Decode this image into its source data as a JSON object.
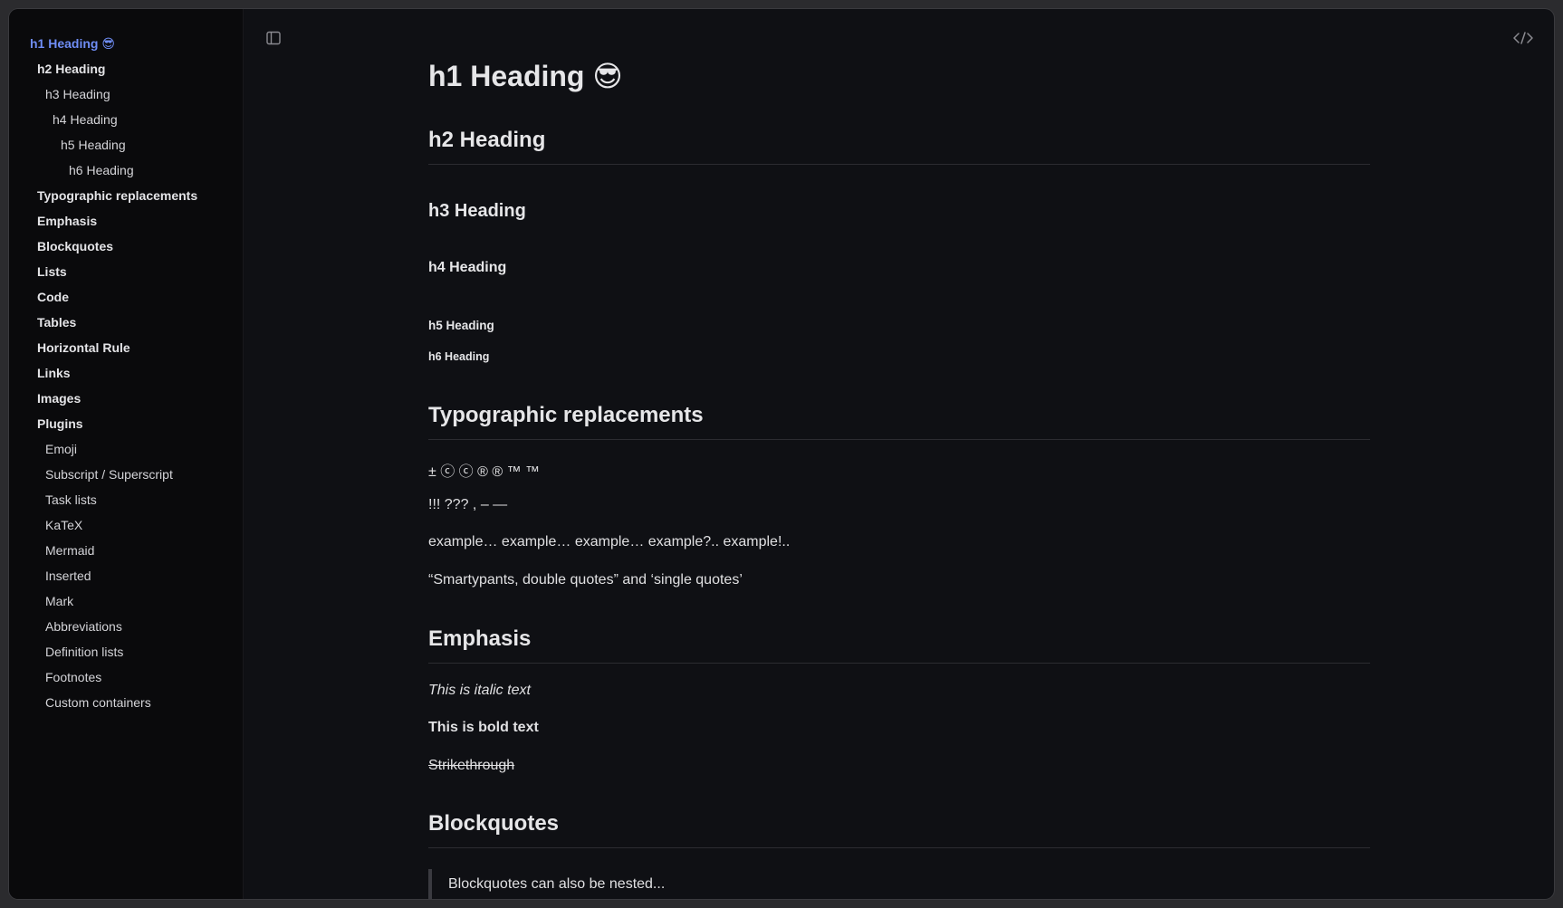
{
  "sidebar": {
    "items": [
      {
        "label": "h1 Heading 😎",
        "level": 1,
        "active": true,
        "bold": true
      },
      {
        "label": "h2 Heading",
        "level": 2,
        "bold": true
      },
      {
        "label": "h3 Heading",
        "level": 3
      },
      {
        "label": "h4 Heading",
        "level": 4
      },
      {
        "label": "h5 Heading",
        "level": 5
      },
      {
        "label": "h6 Heading",
        "level": 6
      },
      {
        "label": "Typographic replacements",
        "level": 2,
        "bold": true
      },
      {
        "label": "Emphasis",
        "level": 2,
        "bold": true
      },
      {
        "label": "Blockquotes",
        "level": 2,
        "bold": true
      },
      {
        "label": "Lists",
        "level": 2,
        "bold": true
      },
      {
        "label": "Code",
        "level": 2,
        "bold": true
      },
      {
        "label": "Tables",
        "level": 2,
        "bold": true
      },
      {
        "label": "Horizontal Rule",
        "level": 2,
        "bold": true
      },
      {
        "label": "Links",
        "level": 2,
        "bold": true
      },
      {
        "label": "Images",
        "level": 2,
        "bold": true
      },
      {
        "label": "Plugins",
        "level": 2,
        "bold": true
      },
      {
        "label": "Emoji",
        "level": 3
      },
      {
        "label": "Subscript / Superscript",
        "level": 3
      },
      {
        "label": "Task lists",
        "level": 3
      },
      {
        "label": "KaTeX",
        "level": 3
      },
      {
        "label": "Mermaid",
        "level": 3
      },
      {
        "label": "Inserted",
        "level": 3
      },
      {
        "label": "Mark",
        "level": 3
      },
      {
        "label": "Abbreviations",
        "level": 3
      },
      {
        "label": "Definition lists",
        "level": 3
      },
      {
        "label": "Footnotes",
        "level": 3
      },
      {
        "label": "Custom containers",
        "level": 3
      }
    ]
  },
  "toolbar": {
    "sidebar_toggle_icon": "sidebar-toggle-icon",
    "code_view_icon": "code-icon"
  },
  "content": {
    "h1": "h1 Heading 😎",
    "h2": "h2 Heading",
    "h3": "h3 Heading",
    "h4": "h4 Heading",
    "h5": "h5 Heading",
    "h6": "h6 Heading",
    "typographic_heading": "Typographic replacements",
    "typo_line1": "± ⓒ ⓒ ® ® ™ ™",
    "typo_line2": "!!! ??? , – —",
    "typo_line3": "example… example… example… example?.. example!..",
    "typo_line4": "“Smartypants, double quotes” and ‘single quotes’",
    "emphasis_heading": "Emphasis",
    "italic_text": "This is italic text",
    "bold_text": "This is bold text",
    "strike_text": "Strikethrough",
    "blockquotes_heading": "Blockquotes",
    "blockquote_text": "Blockquotes can also be nested..."
  },
  "colors": {
    "active_link": "#6f8df5",
    "background": "#0f1014",
    "sidebar_background": "#0a0a0c"
  }
}
